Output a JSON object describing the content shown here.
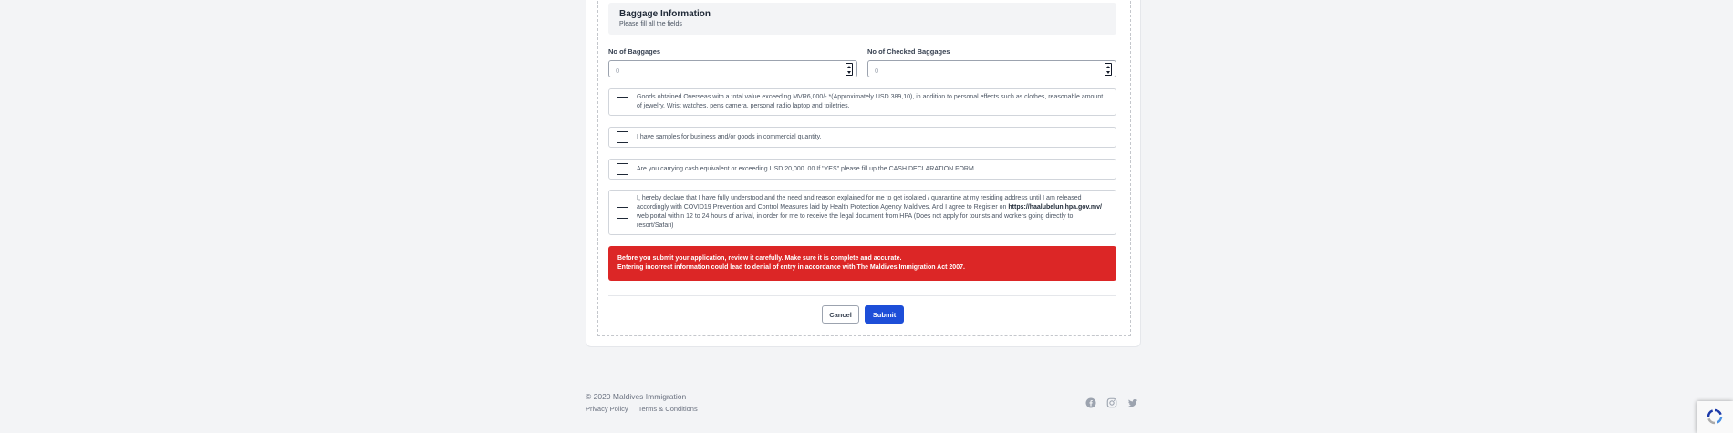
{
  "section": {
    "title": "Baggage Information",
    "subtitle": "Please fill all the fields"
  },
  "fields": {
    "baggages": {
      "label": "No of Baggages",
      "value": "0"
    },
    "checked_baggages": {
      "label": "No of Checked Baggages",
      "value": "0"
    }
  },
  "declarations": [
    {
      "text": "Goods obtained Overseas with a total value exceeding MVR6,000/- *(Approximately USD 389,10), in addition to personal effects such as clothes, reasonable amount of jewelry. Wrist watches, pens camera, personal radio laptop and toiletries.",
      "checked": false
    },
    {
      "text": "I have samples for business and/or goods in commercial quantity.",
      "checked": false
    },
    {
      "text": "Are you carrying cash equivalent or exceeding USD 20,000. 00 If \"YES\" please fill up the CASH DECLARATION FORM.",
      "checked": false
    },
    {
      "text_before": "I, hereby declare that I have fully understood and the need and reason explained for me to get isolated / quarantine at my residing address until I am released accordingly with COVID19 Prevention and Control Measures laid by Health Protection Agency Maldives. And I agree to Register on ",
      "link": "https://haalubelun.hpa.gov.mv/",
      "text_after": " web portal within 12 to 24 hours of arrival, in order for me to receive the legal document from HPA (Does not apply for tourists and workers going directly to resort/Safari)",
      "checked": false
    }
  ],
  "alert": {
    "line1": "Before you submit your application, review it carefully. Make sure it is complete and accurate.",
    "line2": "Entering incorrect information could lead to denial of entry in accordance with The Maldives Immigration Act 2007.",
    "color": "#dc2626"
  },
  "buttons": {
    "cancel": "Cancel",
    "submit": "Submit",
    "submit_color": "#1d4ed8"
  },
  "footer": {
    "copyright": "© 2020 Maldives Immigration",
    "links": [
      "Privacy Policy",
      "Terms & Conditions"
    ],
    "social": [
      "facebook-icon",
      "instagram-icon",
      "twitter-icon"
    ]
  }
}
